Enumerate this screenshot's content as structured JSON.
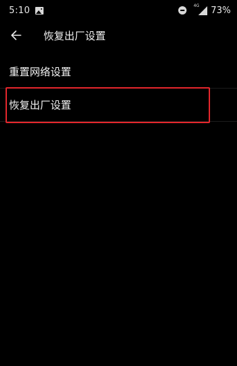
{
  "status_bar": {
    "time": "5:10",
    "network_label": "4G",
    "battery_percent": "73%"
  },
  "app_bar": {
    "title": "恢复出厂设置"
  },
  "menu": {
    "items": [
      {
        "label": "重置网络设置"
      },
      {
        "label": "恢复出厂设置"
      }
    ]
  },
  "highlight": {
    "color": "#e3262c",
    "target_item": 1
  },
  "icons": {
    "status_left": "gallery-icon",
    "status_right": [
      "do-not-disturb-icon",
      "signal-icon"
    ],
    "app_bar": "back-arrow-icon"
  }
}
